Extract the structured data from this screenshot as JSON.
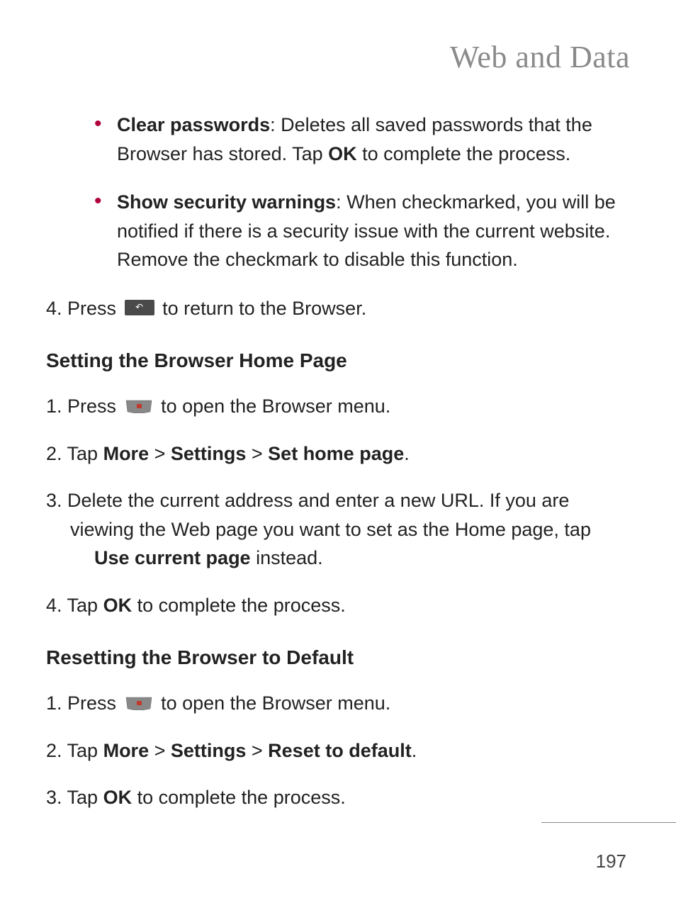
{
  "header": {
    "title": "Web and Data"
  },
  "bullets": [
    {
      "label": "Clear passwords",
      "rest": ": Deletes all saved passwords that the Browser has stored. Tap ",
      "bold2": "OK",
      "rest2": " to complete the process."
    },
    {
      "label": "Show security warnings",
      "rest": ": When checkmarked, you will be notified if there is a security issue with the current website. Remove the checkmark to disable this function."
    }
  ],
  "step4": {
    "prefix": "4. Press ",
    "suffix": " to return to the Browser."
  },
  "section1": {
    "heading": "Setting the Browser Home Page",
    "steps": {
      "s1_prefix": "1. Press ",
      "s1_suffix": " to open the Browser menu.",
      "s2_prefix": "2.  Tap ",
      "s2_b1": "More",
      "s2_sep1": " > ",
      "s2_b2": "Settings",
      "s2_sep2": " > ",
      "s2_b3": "Set home page",
      "s2_end": ".",
      "s3_line1": "3.  Delete the current address and enter a new URL. If you are",
      "s3_line2a": "viewing the Web page you want to set as the Home page, tap ",
      "s3_bold": "Use current page",
      "s3_line2b": " instead.",
      "s4_prefix": "4.  Tap ",
      "s4_bold": "OK",
      "s4_suffix": " to complete the process."
    }
  },
  "section2": {
    "heading": "Resetting the Browser to Default",
    "steps": {
      "s1_prefix": "1.  Press ",
      "s1_suffix": " to open the Browser menu.",
      "s2_prefix": "2.  Tap ",
      "s2_b1": "More",
      "s2_sep1": " > ",
      "s2_b2": "Settings",
      "s2_sep2": " > ",
      "s2_b3": "Reset to default",
      "s2_end": ".",
      "s3_prefix": "3.  Tap ",
      "s3_bold": "OK",
      "s3_suffix": " to complete the process."
    }
  },
  "pageNumber": "197"
}
